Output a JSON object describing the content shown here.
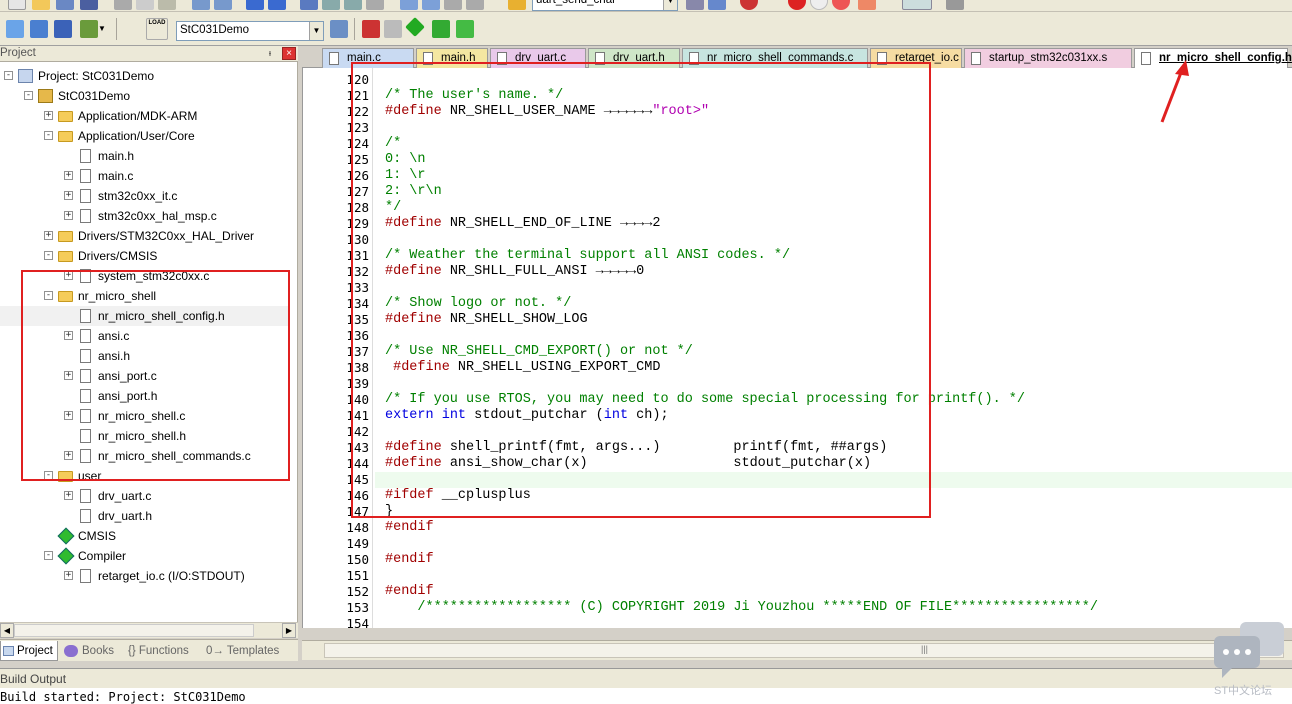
{
  "toolbar": {
    "target_combo": "uart_send_char",
    "project_target": "StC031Demo",
    "load_label": "LOAD"
  },
  "project_panel": {
    "title": "Project",
    "tabs": [
      "Project",
      "Books",
      "{} Functions",
      "0→ Templates"
    ],
    "tree": [
      {
        "label": "Project: StC031Demo",
        "depth": 0,
        "kind": "root",
        "exp": "-"
      },
      {
        "label": "StC031Demo",
        "depth": 1,
        "kind": "target",
        "exp": "-"
      },
      {
        "label": "Application/MDK-ARM",
        "depth": 2,
        "kind": "folder",
        "exp": "+"
      },
      {
        "label": "Application/User/Core",
        "depth": 2,
        "kind": "folder",
        "exp": "-"
      },
      {
        "label": "main.h",
        "depth": 3,
        "kind": "file",
        "exp": ""
      },
      {
        "label": "main.c",
        "depth": 3,
        "kind": "file",
        "exp": "+"
      },
      {
        "label": "stm32c0xx_it.c",
        "depth": 3,
        "kind": "file",
        "exp": "+"
      },
      {
        "label": "stm32c0xx_hal_msp.c",
        "depth": 3,
        "kind": "file",
        "exp": "+"
      },
      {
        "label": "Drivers/STM32C0xx_HAL_Driver",
        "depth": 2,
        "kind": "folder",
        "exp": "+"
      },
      {
        "label": "Drivers/CMSIS",
        "depth": 2,
        "kind": "folder",
        "exp": "-"
      },
      {
        "label": "system_stm32c0xx.c",
        "depth": 3,
        "kind": "file",
        "exp": "+"
      },
      {
        "label": "nr_micro_shell",
        "depth": 2,
        "kind": "folder",
        "exp": "-"
      },
      {
        "label": "nr_micro_shell_config.h",
        "depth": 3,
        "kind": "file",
        "exp": "",
        "selected": true
      },
      {
        "label": "ansi.c",
        "depth": 3,
        "kind": "file",
        "exp": "+"
      },
      {
        "label": "ansi.h",
        "depth": 3,
        "kind": "file",
        "exp": ""
      },
      {
        "label": "ansi_port.c",
        "depth": 3,
        "kind": "file",
        "exp": "+"
      },
      {
        "label": "ansi_port.h",
        "depth": 3,
        "kind": "file",
        "exp": ""
      },
      {
        "label": "nr_micro_shell.c",
        "depth": 3,
        "kind": "file",
        "exp": "+"
      },
      {
        "label": "nr_micro_shell.h",
        "depth": 3,
        "kind": "file",
        "exp": ""
      },
      {
        "label": "nr_micro_shell_commands.c",
        "depth": 3,
        "kind": "file",
        "exp": "+"
      },
      {
        "label": "user",
        "depth": 2,
        "kind": "folder",
        "exp": "-"
      },
      {
        "label": "drv_uart.c",
        "depth": 3,
        "kind": "file",
        "exp": "+"
      },
      {
        "label": "drv_uart.h",
        "depth": 3,
        "kind": "file",
        "exp": ""
      },
      {
        "label": "CMSIS",
        "depth": 2,
        "kind": "gem",
        "exp": ""
      },
      {
        "label": "Compiler",
        "depth": 2,
        "kind": "gem",
        "exp": "-"
      },
      {
        "label": "retarget_io.c (I/O:STDOUT)",
        "depth": 3,
        "kind": "file",
        "exp": "+"
      }
    ]
  },
  "editor_tabs": [
    {
      "label": "main.c",
      "color": "#c9daf2"
    },
    {
      "label": "main.h",
      "color": "#f4e7a1"
    },
    {
      "label": "drv_uart.c",
      "color": "#e9c9ea"
    },
    {
      "label": "drv_uart.h",
      "color": "#cfe6c8"
    },
    {
      "label": "nr_micro_shell_commands.c",
      "color": "#c7e5e0"
    },
    {
      "label": "retarget_io.c",
      "color": "#f6dca2"
    },
    {
      "label": "startup_stm32c031xx.s",
      "color": "#f1cde0"
    },
    {
      "label": "nr_micro_shell_config.h",
      "color": "#ffffff",
      "active": true
    }
  ],
  "code_lines": [
    {
      "n": "120",
      "parts": []
    },
    {
      "n": "121",
      "parts": [
        [
          "cm",
          "/* The user's name. */"
        ]
      ]
    },
    {
      "n": "122",
      "parts": [
        [
          "pp",
          "#define"
        ],
        [
          "tx",
          " NR_SHELL_USER_NAME →→→→→→"
        ],
        [
          "st",
          "\"root>\""
        ]
      ]
    },
    {
      "n": "123",
      "parts": []
    },
    {
      "n": "124",
      "parts": [
        [
          "cm",
          "/*"
        ]
      ]
    },
    {
      "n": "125",
      "parts": [
        [
          "cm",
          "0: \\n"
        ]
      ]
    },
    {
      "n": "126",
      "parts": [
        [
          "cm",
          "1: \\r"
        ]
      ]
    },
    {
      "n": "127",
      "parts": [
        [
          "cm",
          "2: \\r\\n"
        ]
      ]
    },
    {
      "n": "128",
      "parts": [
        [
          "cm",
          "*/"
        ]
      ]
    },
    {
      "n": "129",
      "parts": [
        [
          "pp",
          "#define"
        ],
        [
          "tx",
          " NR_SHELL_END_OF_LINE →→→→"
        ],
        [
          "nm",
          "2"
        ]
      ]
    },
    {
      "n": "130",
      "parts": []
    },
    {
      "n": "131",
      "parts": [
        [
          "cm",
          "/* Weather the terminal support all ANSI codes. */"
        ]
      ]
    },
    {
      "n": "132",
      "parts": [
        [
          "pp",
          "#define"
        ],
        [
          "tx",
          " NR_SHLL_FULL_ANSI →→→→→"
        ],
        [
          "nm",
          "0"
        ]
      ]
    },
    {
      "n": "133",
      "parts": []
    },
    {
      "n": "134",
      "parts": [
        [
          "cm",
          "/* Show logo or not. */"
        ]
      ]
    },
    {
      "n": "135",
      "parts": [
        [
          "pp",
          "#define"
        ],
        [
          "tx",
          " NR_SHELL_SHOW_LOG"
        ]
      ]
    },
    {
      "n": "136",
      "parts": []
    },
    {
      "n": "137",
      "parts": [
        [
          "cm",
          "/* Use NR_SHELL_CMD_EXPORT() or not */"
        ]
      ]
    },
    {
      "n": "138",
      "parts": [
        [
          "tx",
          " "
        ],
        [
          "pp",
          "#define"
        ],
        [
          "tx",
          " NR_SHELL_USING_EXPORT_CMD"
        ]
      ]
    },
    {
      "n": "139",
      "parts": []
    },
    {
      "n": "140",
      "parts": [
        [
          "cm",
          "/* If you use RTOS, you may need to do some special processing for printf(). */"
        ]
      ]
    },
    {
      "n": "141",
      "parts": [
        [
          "kw",
          "extern"
        ],
        [
          "tx",
          " "
        ],
        [
          "kw",
          "int"
        ],
        [
          "tx",
          " stdout_putchar ("
        ],
        [
          "kw",
          "int"
        ],
        [
          "tx",
          " ch);"
        ]
      ]
    },
    {
      "n": "142",
      "parts": []
    },
    {
      "n": "143",
      "parts": [
        [
          "pp",
          "#define"
        ],
        [
          "tx",
          " shell_printf(fmt, args...)         printf(fmt, ##args)"
        ]
      ]
    },
    {
      "n": "144",
      "parts": [
        [
          "pp",
          "#define"
        ],
        [
          "tx",
          " ansi_show_char(x)                  stdout_putchar(x)"
        ]
      ]
    },
    {
      "n": "145",
      "parts": [],
      "highlight": true
    },
    {
      "n": "146",
      "parts": [
        [
          "pp",
          "#ifdef"
        ],
        [
          "tx",
          " __cplusplus"
        ]
      ]
    },
    {
      "n": "147",
      "parts": [
        [
          "tx",
          "}"
        ]
      ]
    },
    {
      "n": "148",
      "parts": [
        [
          "pp",
          "#endif"
        ]
      ]
    },
    {
      "n": "149",
      "parts": []
    },
    {
      "n": "150",
      "parts": [
        [
          "pp",
          "#endif"
        ]
      ]
    },
    {
      "n": "151",
      "parts": []
    },
    {
      "n": "152",
      "parts": [
        [
          "pp",
          "#endif"
        ]
      ]
    },
    {
      "n": "153",
      "parts": [
        [
          "cm",
          "    /****************** (C) COPYRIGHT 2019 Ji Youzhou *****END OF FILE*****************/"
        ]
      ]
    },
    {
      "n": "154",
      "parts": []
    }
  ],
  "build_output": {
    "title": "Build Output",
    "text": "Build started: Project: StC031Demo"
  },
  "watermark": {
    "text": "ST中文论坛"
  },
  "colors": {
    "annotation": "#e02020",
    "comment": "#008000",
    "preprocessor": "#a00000",
    "keyword": "#0000e0",
    "string": "#b000b0"
  }
}
